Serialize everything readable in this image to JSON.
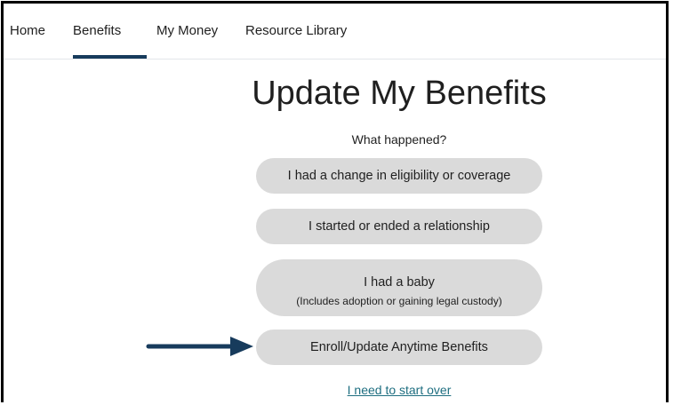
{
  "nav": {
    "items": [
      {
        "label": "Home"
      },
      {
        "label": "Benefits"
      },
      {
        "label": "My Money"
      },
      {
        "label": "Resource Library"
      }
    ],
    "active": "Benefits",
    "accent_color": "#173b5c"
  },
  "page": {
    "title": "Update My Benefits",
    "subtitle": "What happened?"
  },
  "choices": [
    {
      "label": "I had a change in eligibility or coverage"
    },
    {
      "label": "I started or ended a relationship"
    },
    {
      "label": "I had a baby",
      "sublabel": "(Includes adoption or gaining legal custody)"
    },
    {
      "label": "Enroll/Update Anytime Benefits"
    }
  ],
  "annotation": {
    "icon": "right-arrow-icon",
    "color": "#173b5c",
    "points_to": "Enroll/Update Anytime Benefits"
  },
  "links": {
    "start_over": "I need to start over"
  },
  "colors": {
    "button_bg": "#dadada",
    "link": "#1e6e80",
    "frame_border": "#000000"
  }
}
